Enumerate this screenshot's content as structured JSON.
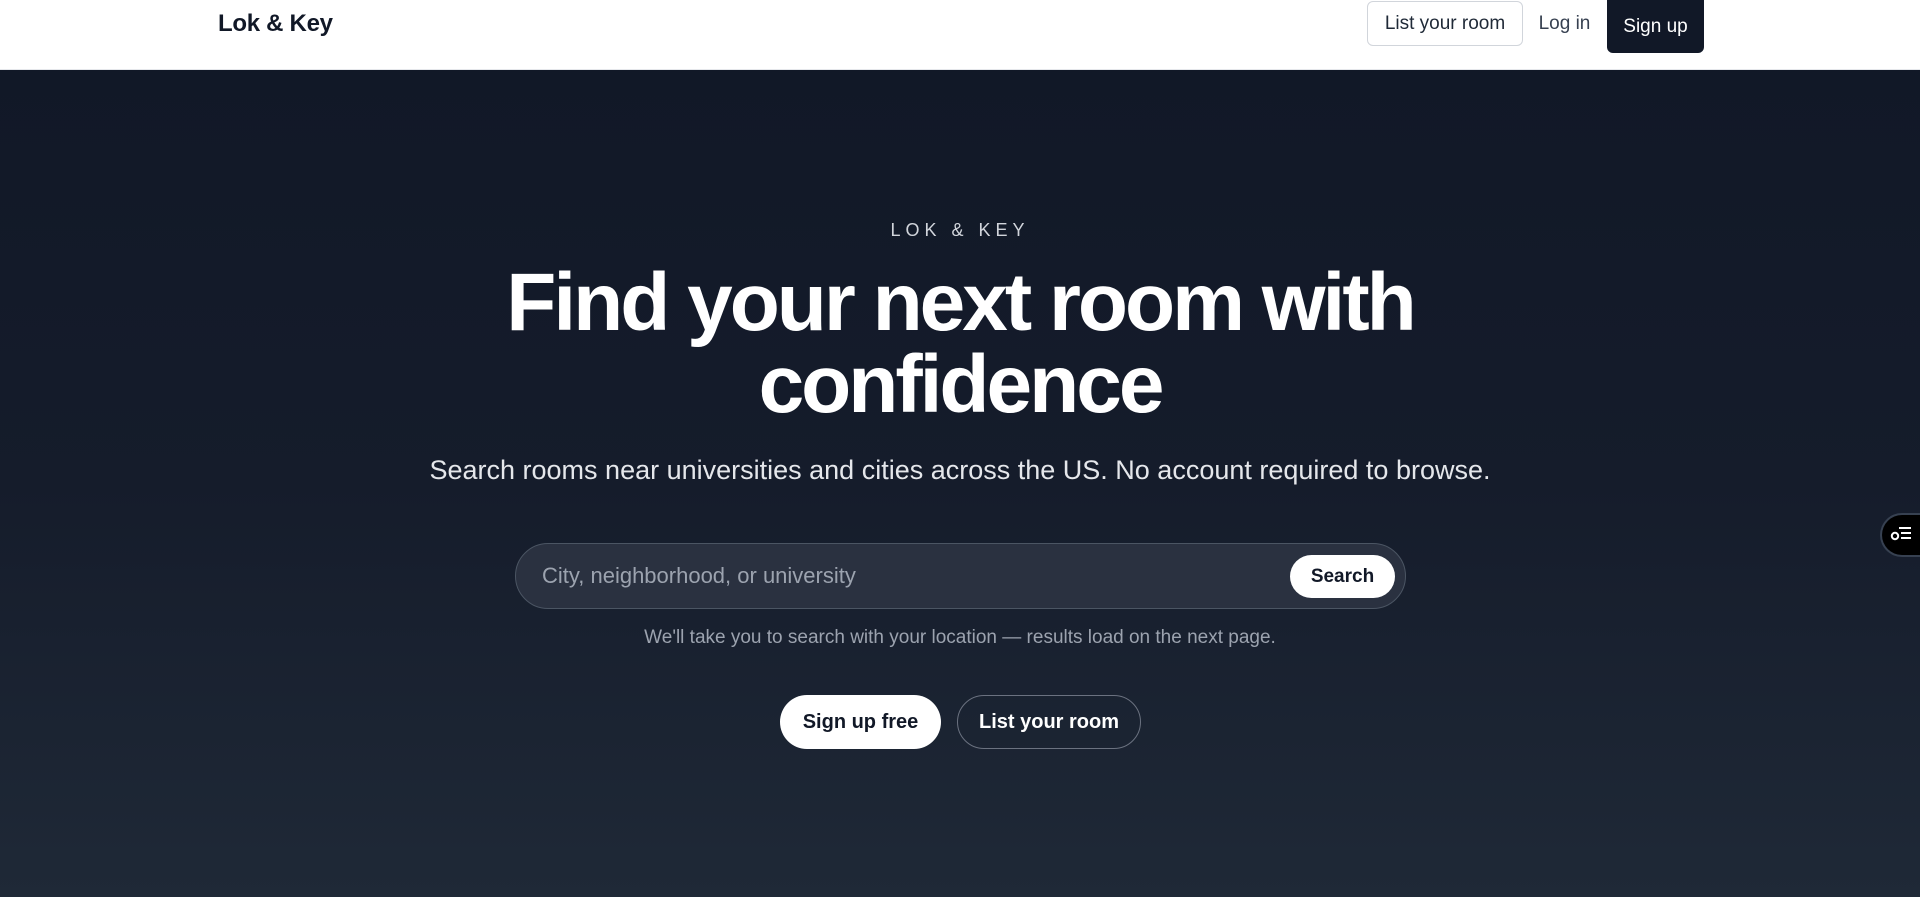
{
  "header": {
    "brand": "Lok & Key",
    "list_room_label": "List your room",
    "login_label": "Log in",
    "signup_label": "Sign up"
  },
  "hero": {
    "eyebrow": "LOK & KEY",
    "headline": "Find your next room with confidence",
    "subheadline": "Search rooms near universities and cities across the US. No account required to browse.",
    "search": {
      "placeholder": "City, neighborhood, or university",
      "value": "",
      "button_label": "Search"
    },
    "hint": "We'll take you to search with your location — results load on the next page.",
    "cta_signup_label": "Sign up free",
    "cta_list_label": "List your room"
  },
  "floating_widget": {
    "icon": "filter-list-icon"
  },
  "colors": {
    "hero_bg_top": "#111827",
    "hero_bg_bottom": "#1f2937",
    "accent_dark": "#111827",
    "text_light": "#ffffff"
  }
}
